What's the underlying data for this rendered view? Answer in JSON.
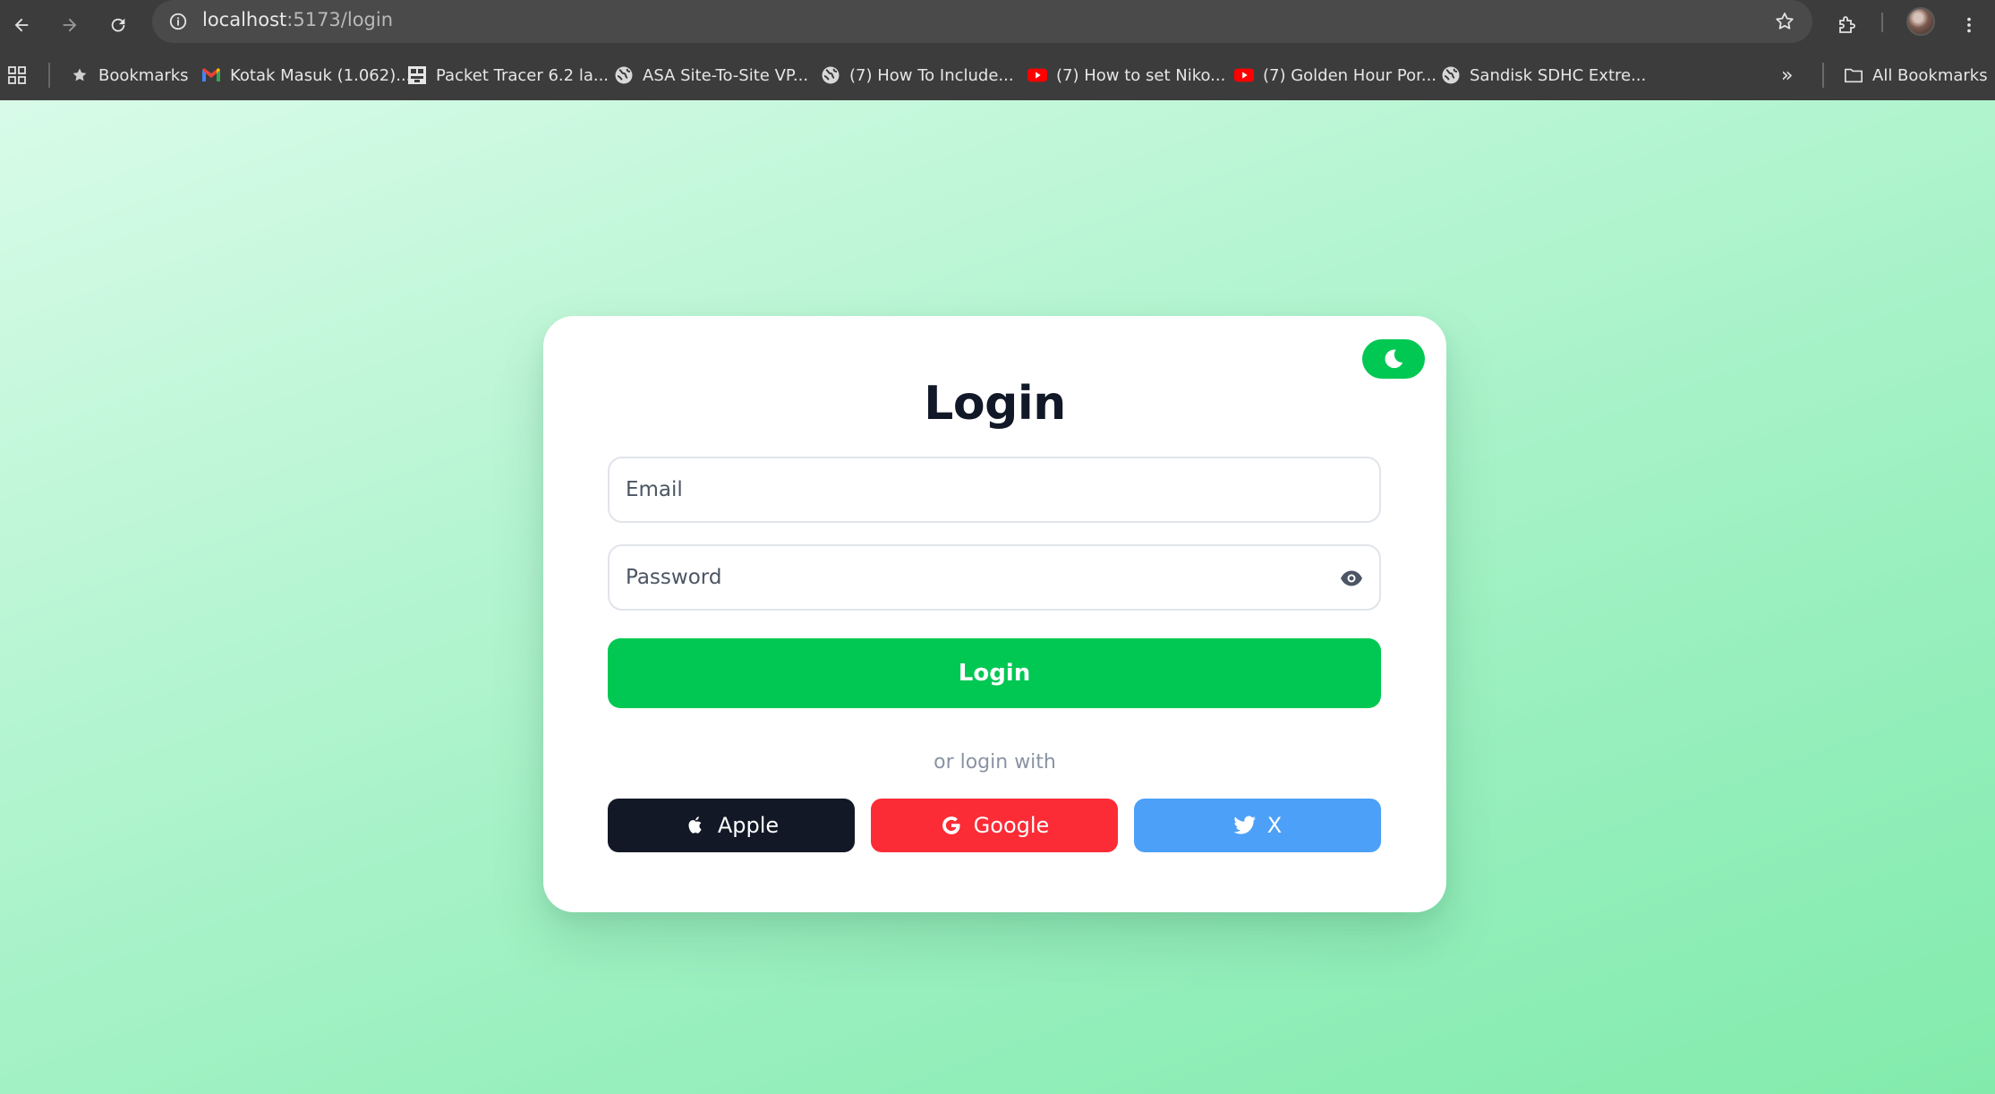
{
  "browser": {
    "url_host": "localhost",
    "url_path": ":5173/login",
    "bookmarks": [
      {
        "label": "Bookmarks",
        "icon": "star-icon"
      },
      {
        "label": "Kotak Masuk (1.062)...",
        "icon": "gmail-icon"
      },
      {
        "label": "Packet Tracer 6.2 la...",
        "icon": "packet-tracer-icon"
      },
      {
        "label": "ASA Site-To-Site VP...",
        "icon": "globe-icon"
      },
      {
        "label": "(7) How To Include...",
        "icon": "globe-icon"
      },
      {
        "label": "(7) How to set Niko...",
        "icon": "youtube-icon"
      },
      {
        "label": "(7) Golden Hour Por...",
        "icon": "youtube-icon"
      },
      {
        "label": "Sandisk SDHC Extre...",
        "icon": "globe-icon"
      }
    ],
    "more_label": "»",
    "all_bookmarks_label": "All Bookmarks"
  },
  "login": {
    "title": "Login",
    "email_placeholder": "Email",
    "password_placeholder": "Password",
    "submit_label": "Login",
    "divider_text": "or login with",
    "social": {
      "apple": "Apple",
      "google": "Google",
      "x": "X"
    }
  },
  "colors": {
    "accent": "#00c853",
    "apple": "#121826",
    "google": "#fb2c36",
    "x": "#4da0f7"
  }
}
